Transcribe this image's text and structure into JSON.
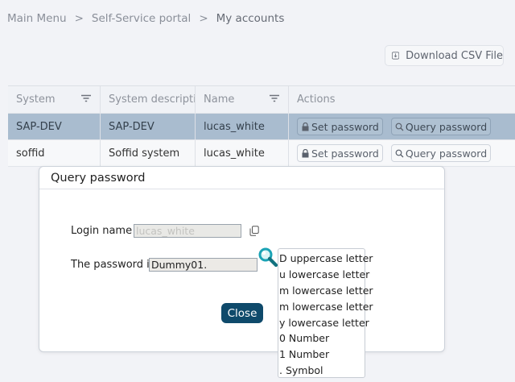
{
  "breadcrumb": {
    "items": [
      "Main Menu",
      "Self-Service portal",
      "My accounts"
    ],
    "separator": ">"
  },
  "toolbar": {
    "download_csv_label": "Download CSV File"
  },
  "table": {
    "headers": [
      "System",
      "System description",
      "Name",
      "Actions"
    ],
    "rows": [
      {
        "system": "SAP-DEV",
        "description": "SAP-DEV",
        "name": "lucas_white",
        "selected": true
      },
      {
        "system": "soffid",
        "description": "Soffid system",
        "name": "lucas_white",
        "selected": false
      }
    ],
    "actions": {
      "set_password": "Set password",
      "query_password": "Query password"
    }
  },
  "dialog": {
    "title": "Query password",
    "login_label": "Login name :",
    "login_value": "lucas_white",
    "password_label": "The password is:",
    "password_value": "Dummy01.",
    "close_label": "Close"
  },
  "password_legend": [
    "D uppercase letter",
    "u lowercase letter",
    "m lowercase letter",
    "m lowercase letter",
    "y lowercase letter",
    "0 Number",
    "1 Number",
    ". Symbol"
  ],
  "colors": {
    "selected_row": "#a9bccf",
    "primary_button": "#0f4a6b",
    "magnifier_accent": "#1aa3b5"
  }
}
